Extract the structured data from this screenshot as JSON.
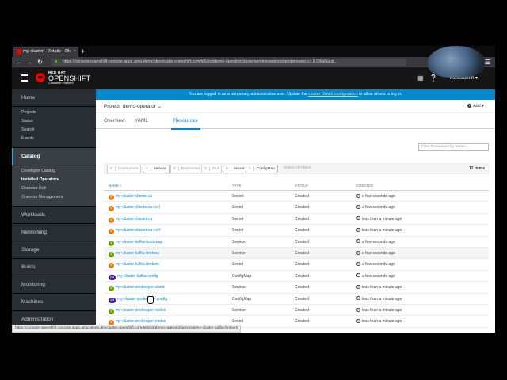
{
  "browser": {
    "tab_title": "my-cluster - Details · Ok",
    "tab_close": "×",
    "new_tab": "+",
    "url": "https://console-openshift-console.apps.amq-demo.devcluster.openshift.com/k8s/ns/demo-operator/clusterserviceversions/amqstreams.v1.0.0/kafka.st...",
    "status_url": "https://console-openshift-console.apps.amq-demo.devcluster.openshift.com/k8s/ns/demo-operator/services/my-cluster-kafka-brokers"
  },
  "masthead": {
    "brand_line1": "RED HAT",
    "brand_line2": "OPENSHIFT",
    "brand_line3": "Container Platform",
    "user": "kubeadmin"
  },
  "sidebar": {
    "home": "Home",
    "home_items": [
      "Projects",
      "Status",
      "Search",
      "Events"
    ],
    "catalog": "Catalog",
    "catalog_items": [
      "Developer Catalog",
      "Installed Operators",
      "Operator Hub",
      "Operator Management"
    ],
    "sections": [
      "Workloads",
      "Networking",
      "Storage",
      "Builds",
      "Monitoring",
      "Machines",
      "Administration"
    ]
  },
  "alert": {
    "text_before": "You are logged in as a temporary administrative user. Update the ",
    "link": "cluster OAuth configuration",
    "text_after": " to allow others to log in."
  },
  "project": {
    "label": "Project:",
    "value": "demo-operator ⌄"
  },
  "add_button": "Add",
  "tabs": [
    "Overview",
    "YAML",
    "Resources"
  ],
  "filter_placeholder": "Filter Resources by name...",
  "filters": [
    {
      "count": "0",
      "label": "Deployment",
      "dim": true
    },
    {
      "count": "4",
      "label": "Service",
      "dim": false
    },
    {
      "count": "0",
      "label": "ReplicaSet",
      "dim": true
    },
    {
      "count": "0",
      "label": "Pod",
      "dim": true
    },
    {
      "count": "6",
      "label": "Secret",
      "dim": false
    },
    {
      "count": "2",
      "label": "ConfigMap",
      "dim": false
    }
  ],
  "select_all": "Select All Filters",
  "item_count": "12 Items",
  "columns": [
    "NAME ↑",
    "TYPE",
    "STATUS",
    "CREATED"
  ],
  "rows": [
    {
      "badge": "S",
      "name": "my-cluster-clients-ca",
      "type": "Secret",
      "status": "Created",
      "created": "a few seconds ago"
    },
    {
      "badge": "S",
      "name": "my-cluster-clients-ca-cert",
      "type": "Secret",
      "status": "Created",
      "created": "a few seconds ago"
    },
    {
      "badge": "S",
      "name": "my-cluster-cluster-ca",
      "type": "Secret",
      "status": "Created",
      "created": "less than a minute ago"
    },
    {
      "badge": "S",
      "name": "my-cluster-cluster-ca-cert",
      "type": "Secret",
      "status": "Created",
      "created": "less than a minute ago"
    },
    {
      "badge": "S",
      "name": "my-cluster-kafka-bootstrap",
      "type": "Service",
      "status": "Created",
      "created": "a few seconds ago"
    },
    {
      "badge": "S",
      "name": "my-cluster-kafka-brokers",
      "type": "Service",
      "status": "Created",
      "created": "a few seconds ago"
    },
    {
      "badge": "S",
      "name": "my-cluster-kafka-brokers",
      "type": "Secret",
      "status": "Created",
      "created": "a few seconds ago"
    },
    {
      "badge": "CM",
      "name": "my-cluster-kafka-config",
      "type": "ConfigMap",
      "status": "Created",
      "created": "a few seconds ago"
    },
    {
      "badge": "S",
      "name": "my-cluster-zookeeper-client",
      "type": "Service",
      "status": "Created",
      "created": "less than a minute ago"
    },
    {
      "badge": "CM",
      "name": "my-cluster-zookeeper-config",
      "type": "ConfigMap",
      "status": "Created",
      "created": "less than a minute ago"
    },
    {
      "badge": "S",
      "name": "my-cluster-zookeeper-nodes",
      "type": "Service",
      "status": "Created",
      "created": "less than a minute ago"
    },
    {
      "badge": "S",
      "name": "my-cluster-zookeeper-nodes",
      "type": "Secret",
      "status": "Created",
      "created": "less than a minute ago"
    }
  ],
  "colors": {
    "accent": "#0088ce",
    "secret": "#ec7a08",
    "service": "#6ca100",
    "configmap": "#40199a",
    "masthead": "#161616",
    "sidebar": "#292e34"
  }
}
